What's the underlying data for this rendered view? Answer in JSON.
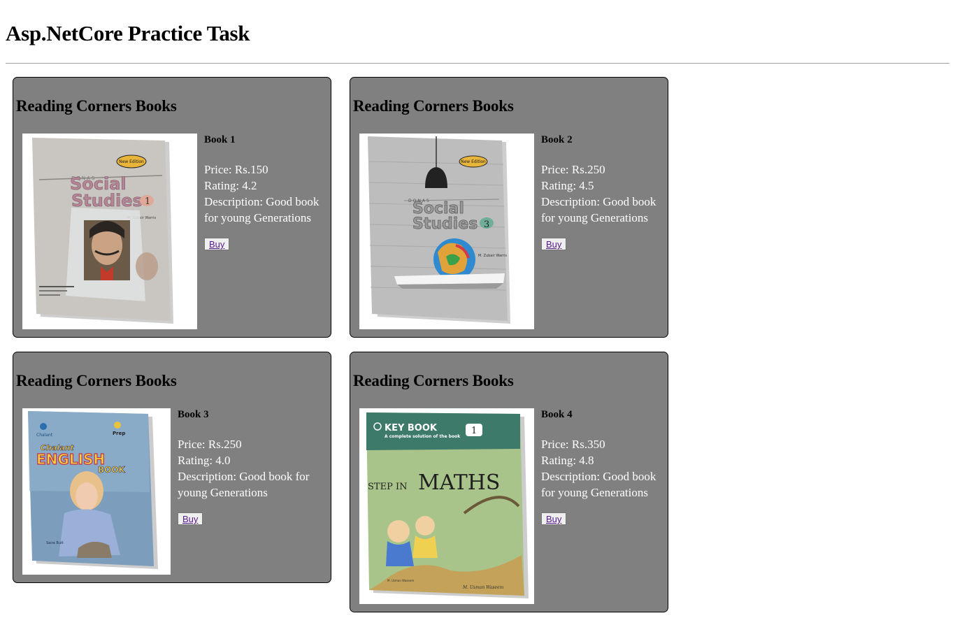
{
  "page": {
    "title": "Asp.NetCore Practice Task"
  },
  "cards": [
    {
      "heading": "Reading Corners Books",
      "name": "Book 1",
      "price": "Price: Rs.150",
      "rating": "Rating: 4.2",
      "description": "Description: Good book for young Generations",
      "buy": "Buy",
      "cover": {
        "brand": "DONAS",
        "badge": "New Edition",
        "title1": "Social",
        "title2": "Studies",
        "grade": "1",
        "author": "M. Zubair Warris"
      }
    },
    {
      "heading": "Reading Corners Books",
      "name": "Book 2",
      "price": "Price: Rs.250",
      "rating": "Rating: 4.5",
      "description": "Description: Good book for young Generations",
      "buy": "Buy",
      "cover": {
        "brand": "DONAS",
        "badge": "New Edition",
        "title1": "Social",
        "title2": "Studies",
        "grade": "3",
        "author": "M. Zubair Warris"
      }
    },
    {
      "heading": "Reading Corners Books",
      "name": "Book 3",
      "price": "Price: Rs.250",
      "rating": "Rating: 4.0",
      "description": "Description: Good book for young Generations",
      "buy": "Buy",
      "cover": {
        "top": "Chalant",
        "title1": "ENGLISH",
        "title2": "BOOK",
        "grade": "Prep",
        "author": "Saira Butt"
      }
    },
    {
      "heading": "Reading Corners Books",
      "name": "Book 4",
      "price": "Price: Rs.350",
      "rating": "Rating: 4.8",
      "description": "Description: Good book for young Generations",
      "buy": "Buy",
      "cover": {
        "top": "KEY BOOK",
        "subtitle": "A complete solution of the book",
        "title1": "STEP IN",
        "title2": "MATHS",
        "grade": "1",
        "author": "M. Usman Waseem"
      }
    }
  ]
}
